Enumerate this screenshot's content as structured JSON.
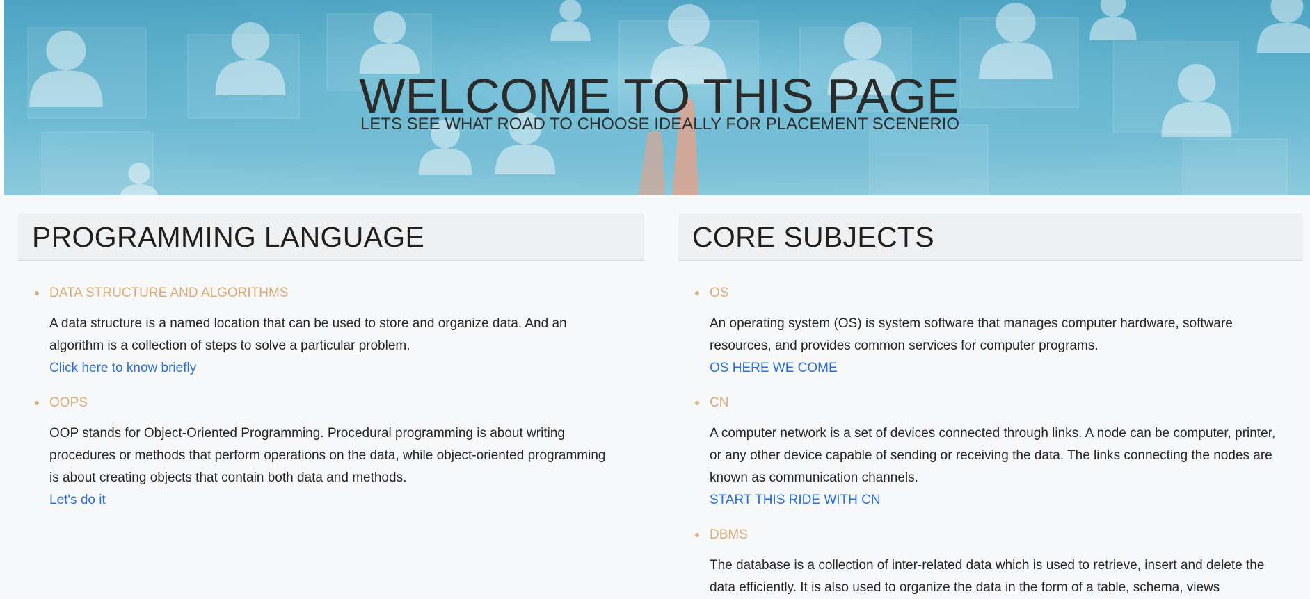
{
  "hero": {
    "title": "WELCOME TO THIS PAGE",
    "subtitle": "LETS SEE WHAT ROAD TO CHOOSE IDEALLY FOR PLACEMENT SCENERIO"
  },
  "programming": {
    "heading": "PROGRAMMING LANGUAGE",
    "topics": [
      {
        "title": "DATA STRUCTURE AND ALGORITHMS",
        "description": "A data structure is a named location that can be used to store and organize data. And an algorithm is a collection of steps to solve a particular problem.",
        "link": "Click here to know briefly"
      },
      {
        "title": "OOPS",
        "description": "OOP stands for Object-Oriented Programming. Procedural programming is about writing procedures or methods that perform operations on the data, while object-oriented programming is about creating objects that contain both data and methods.",
        "link": "Let's do it"
      }
    ]
  },
  "core": {
    "heading": "CORE SUBJECTS",
    "topics": [
      {
        "title": "OS",
        "description": "An operating system (OS) is system software that manages computer hardware, software resources, and provides common services for computer programs.",
        "link": "OS HERE WE COME"
      },
      {
        "title": "CN",
        "description": "A computer network is a set of devices connected through links. A node can be computer, printer, or any other device capable of sending or receiving the data. The links connecting the nodes are known as communication channels.",
        "link": "START THIS RIDE WITH CN"
      },
      {
        "title": "DBMS",
        "description": "The database is a collection of inter-related data which is used to retrieve, insert and delete the data efficiently. It is also used to organize the data in the form of a table, schema, views"
      }
    ]
  },
  "colors": {
    "topic_title": "#d9ad78",
    "link": "#2d6fd6",
    "hero_background": "#4da4c2"
  }
}
